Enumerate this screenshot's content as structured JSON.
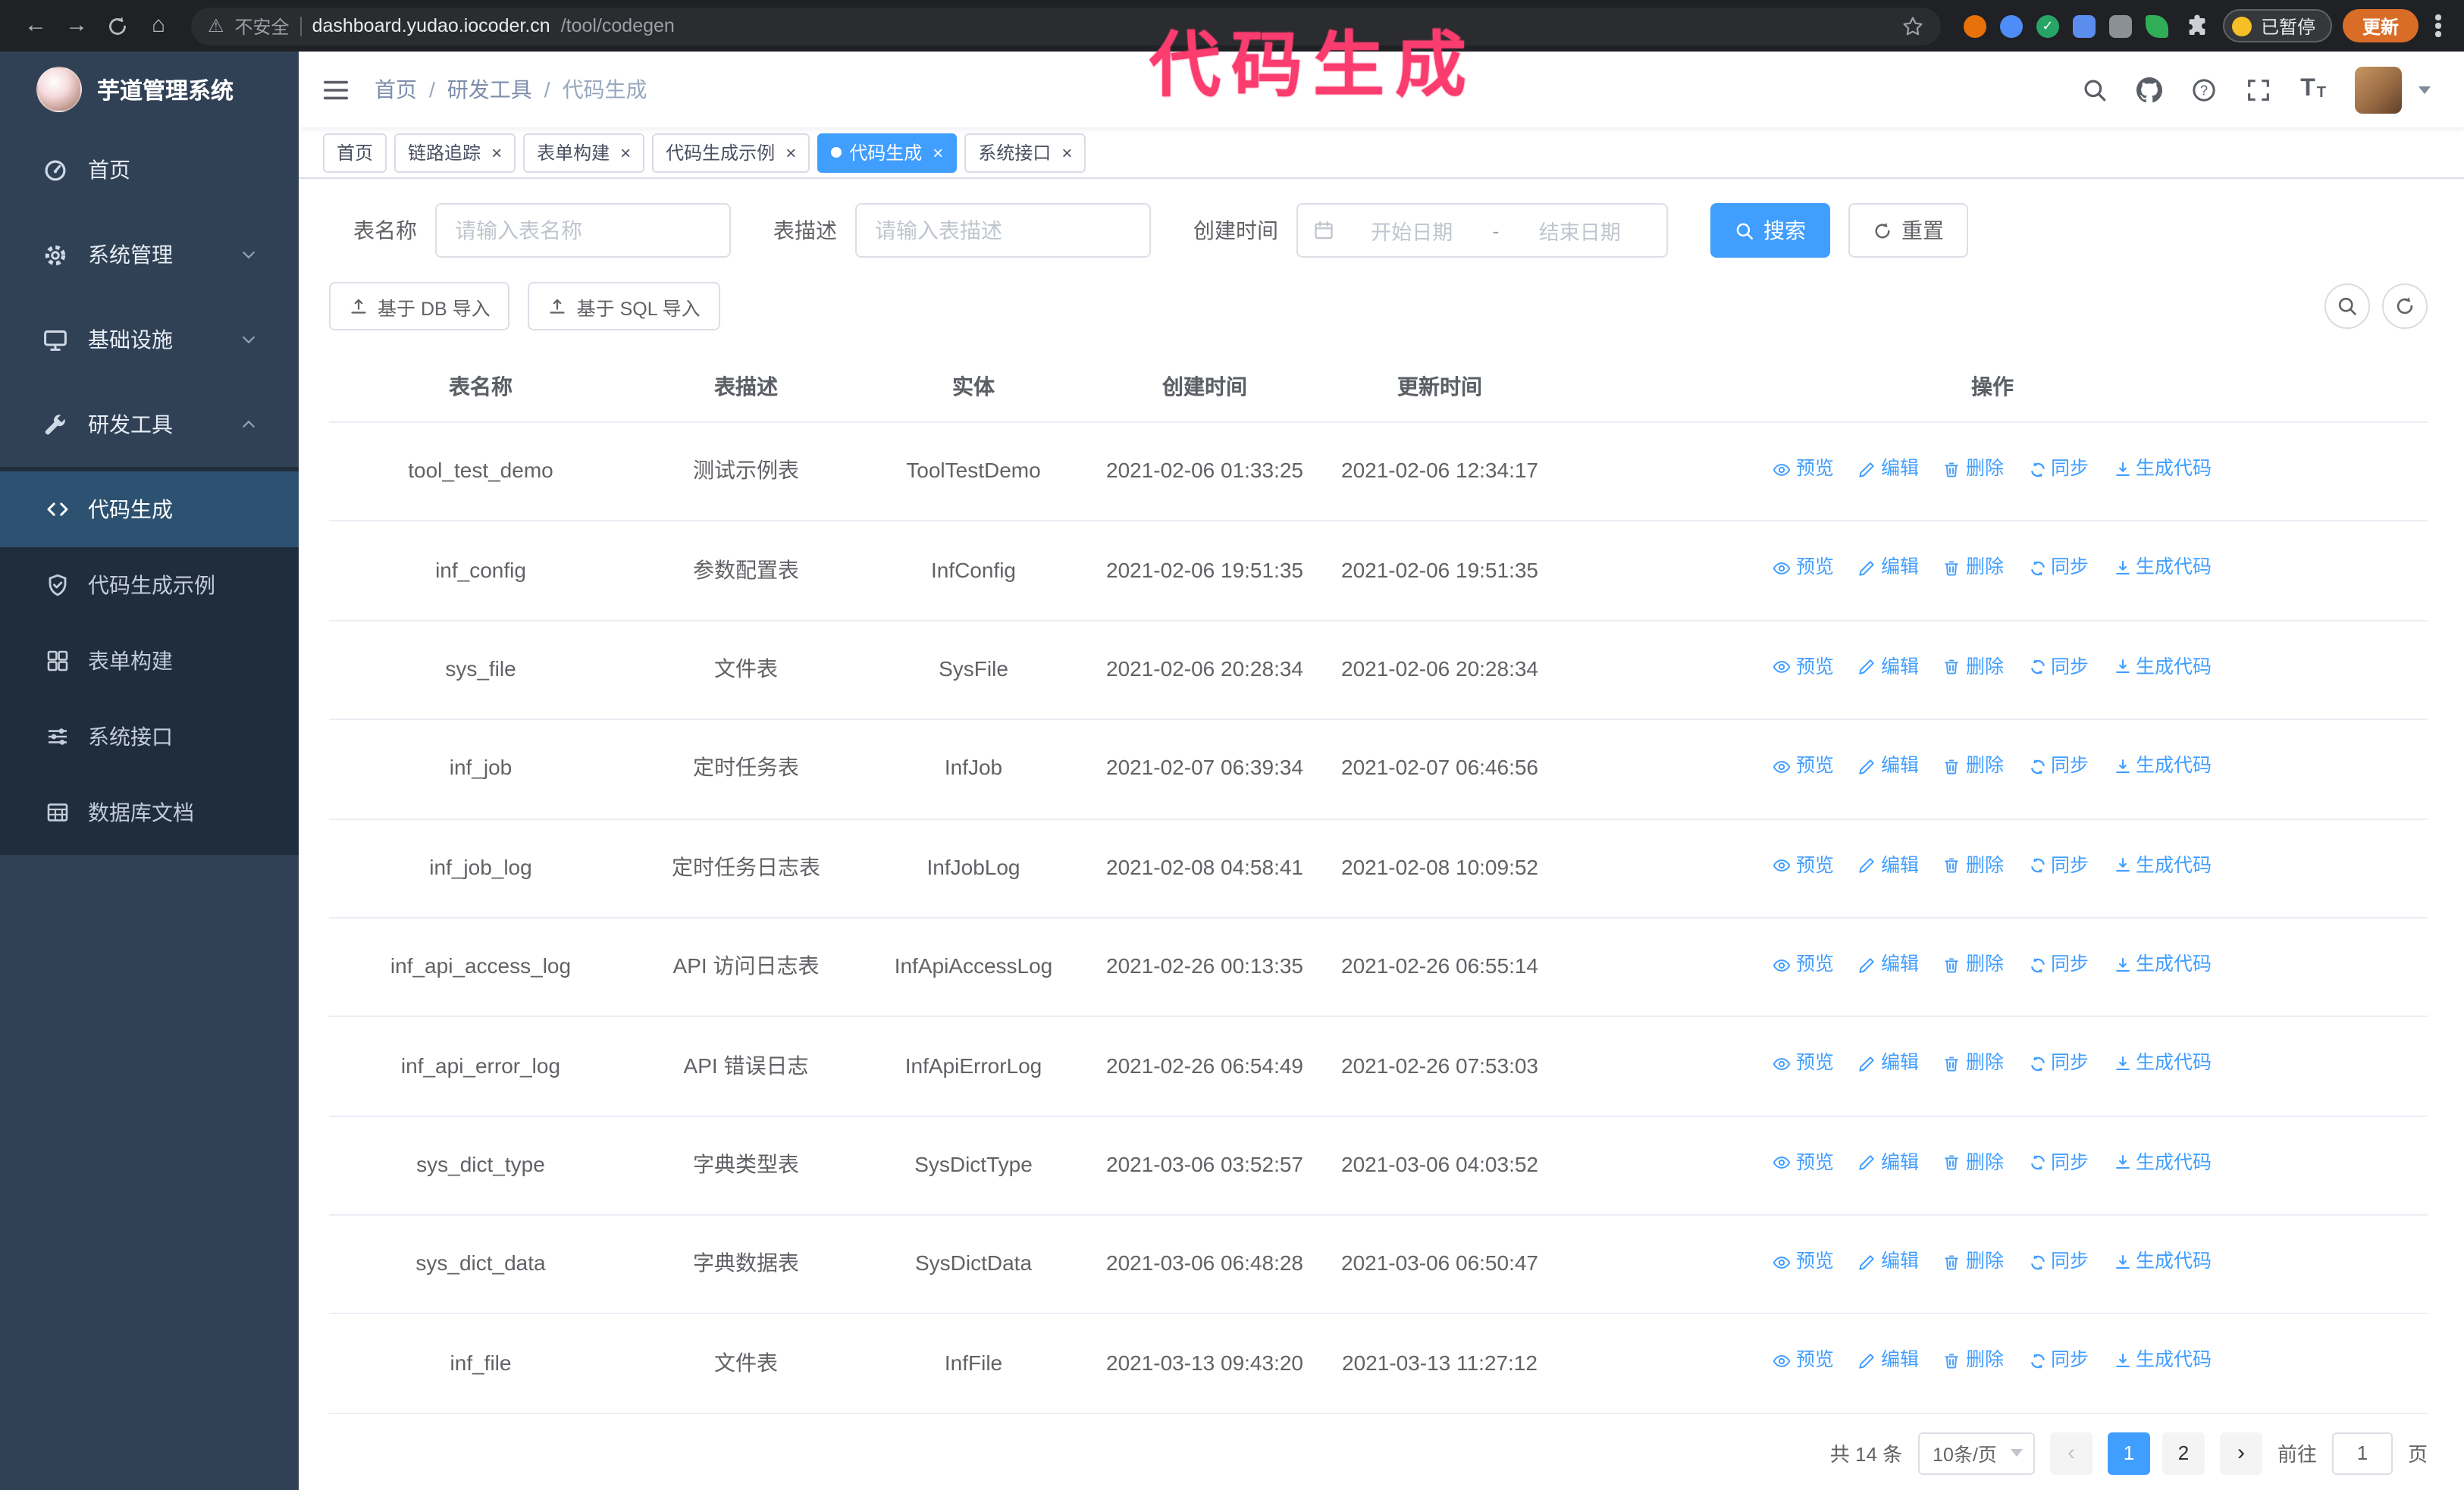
{
  "colors": {
    "accent": "#409eff",
    "annotation": "#fa3c6e",
    "sidebar_bg": "#304156",
    "submenu_bg": "#1f2d3d",
    "active_menu_bg": "#2d5170",
    "chrome_bg": "#202124",
    "update_button": "#d96c27",
    "tab_border": "#d8dce5",
    "table_border": "#ebeef5"
  },
  "browser": {
    "security_label": "不安全",
    "url_host": "dashboard.yudao.iocoder.cn",
    "url_path": "/tool/codegen",
    "paused_label": "已暂停",
    "update_label": "更新",
    "extensions": [
      {
        "name": "extension-orange-icon",
        "color": "#e8710a",
        "shape": "circle"
      },
      {
        "name": "extension-blue-icon",
        "color": "#4e8cf7",
        "shape": "circle"
      },
      {
        "name": "extension-green-check-icon",
        "color": "#27a567",
        "shape": "check"
      },
      {
        "name": "extension-people-icon",
        "color": "#5b8def",
        "shape": "square"
      },
      {
        "name": "extension-gray-icon",
        "color": "#8a9096",
        "shape": "square"
      },
      {
        "name": "extension-leaf-icon",
        "color": "#2fae57",
        "shape": "leaf"
      }
    ]
  },
  "annotation": {
    "text": "代码生成"
  },
  "sidebar": {
    "logo_title": "芋道管理系统",
    "items": [
      {
        "label": "首页",
        "icon": "dashboard-icon",
        "expandable": false,
        "expanded": false,
        "active": false
      },
      {
        "label": "系统管理",
        "icon": "gear-icon",
        "expandable": true,
        "expanded": false,
        "active": false
      },
      {
        "label": "基础设施",
        "icon": "monitor-icon",
        "expandable": true,
        "expanded": false,
        "active": false
      },
      {
        "label": "研发工具",
        "icon": "tools-icon",
        "expandable": true,
        "expanded": true,
        "active": true
      }
    ],
    "submenu": [
      {
        "label": "代码生成",
        "icon": "code-icon",
        "active": true
      },
      {
        "label": "代码生成示例",
        "icon": "shield-check-icon",
        "active": false
      },
      {
        "label": "表单构建",
        "icon": "form-grid-icon",
        "active": false
      },
      {
        "label": "系统接口",
        "icon": "sliders-icon",
        "active": false
      },
      {
        "label": "数据库文档",
        "icon": "table-grid-icon",
        "active": false
      }
    ]
  },
  "header": {
    "breadcrumb": [
      "首页",
      "研发工具",
      "代码生成"
    ],
    "separator": "/",
    "icons": [
      "search-icon",
      "github-icon",
      "help-icon",
      "fullscreen-icon",
      "font-size-icon",
      "user-avatar",
      "caret-down-icon"
    ]
  },
  "tabs": [
    {
      "label": "首页",
      "closable": false,
      "active": false
    },
    {
      "label": "链路追踪",
      "closable": true,
      "active": false
    },
    {
      "label": "表单构建",
      "closable": true,
      "active": false
    },
    {
      "label": "代码生成示例",
      "closable": true,
      "active": false
    },
    {
      "label": "代码生成",
      "closable": true,
      "active": true
    },
    {
      "label": "系统接口",
      "closable": true,
      "active": false
    }
  ],
  "filters": {
    "name_label": "表名称",
    "name_placeholder": "请输入表名称",
    "desc_label": "表描述",
    "desc_placeholder": "请输入表描述",
    "time_label": "创建时间",
    "start_placeholder": "开始日期",
    "range_separator": "-",
    "end_placeholder": "结束日期",
    "search_label": "搜索",
    "reset_label": "重置"
  },
  "toolbar": {
    "import_db_label": "基于 DB 导入",
    "import_sql_label": "基于 SQL 导入"
  },
  "table": {
    "columns": [
      "表名称",
      "表描述",
      "实体",
      "创建时间",
      "更新时间",
      "操作"
    ],
    "actions": [
      {
        "label": "预览",
        "icon": "eye-icon"
      },
      {
        "label": "编辑",
        "icon": "edit-icon"
      },
      {
        "label": "删除",
        "icon": "delete-icon"
      },
      {
        "label": "同步",
        "icon": "sync-icon"
      },
      {
        "label": "生成代码",
        "icon": "download-icon"
      }
    ],
    "rows": [
      {
        "name": "tool_test_demo",
        "description": "测试示例表",
        "entity": "ToolTestDemo",
        "created": "2021-02-06 01:33:25",
        "updated": "2021-02-06 12:34:17"
      },
      {
        "name": "inf_config",
        "description": "参数配置表",
        "entity": "InfConfig",
        "created": "2021-02-06 19:51:35",
        "updated": "2021-02-06 19:51:35"
      },
      {
        "name": "sys_file",
        "description": "文件表",
        "entity": "SysFile",
        "created": "2021-02-06 20:28:34",
        "updated": "2021-02-06 20:28:34"
      },
      {
        "name": "inf_job",
        "description": "定时任务表",
        "entity": "InfJob",
        "created": "2021-02-07 06:39:34",
        "updated": "2021-02-07 06:46:56"
      },
      {
        "name": "inf_job_log",
        "description": "定时任务日志表",
        "entity": "InfJobLog",
        "created": "2021-02-08 04:58:41",
        "updated": "2021-02-08 10:09:52"
      },
      {
        "name": "inf_api_access_log",
        "description": "API 访问日志表",
        "entity": "InfApiAccessLog",
        "created": "2021-02-26 00:13:35",
        "updated": "2021-02-26 06:55:14"
      },
      {
        "name": "inf_api_error_log",
        "description": "API 错误日志",
        "entity": "InfApiErrorLog",
        "created": "2021-02-26 06:54:49",
        "updated": "2021-02-26 07:53:03"
      },
      {
        "name": "sys_dict_type",
        "description": "字典类型表",
        "entity": "SysDictType",
        "created": "2021-03-06 03:52:57",
        "updated": "2021-03-06 04:03:52"
      },
      {
        "name": "sys_dict_data",
        "description": "字典数据表",
        "entity": "SysDictData",
        "created": "2021-03-06 06:48:28",
        "updated": "2021-03-06 06:50:47"
      },
      {
        "name": "inf_file",
        "description": "文件表",
        "entity": "InfFile",
        "created": "2021-03-13 09:43:20",
        "updated": "2021-03-13 11:27:12"
      }
    ]
  },
  "pagination": {
    "total_label": "共 14 条",
    "page_size_label": "10条/页",
    "pages": [
      "1",
      "2"
    ],
    "active_page": "1",
    "goto_label": "前往",
    "goto_value": "1",
    "page_suffix_label": "页"
  }
}
